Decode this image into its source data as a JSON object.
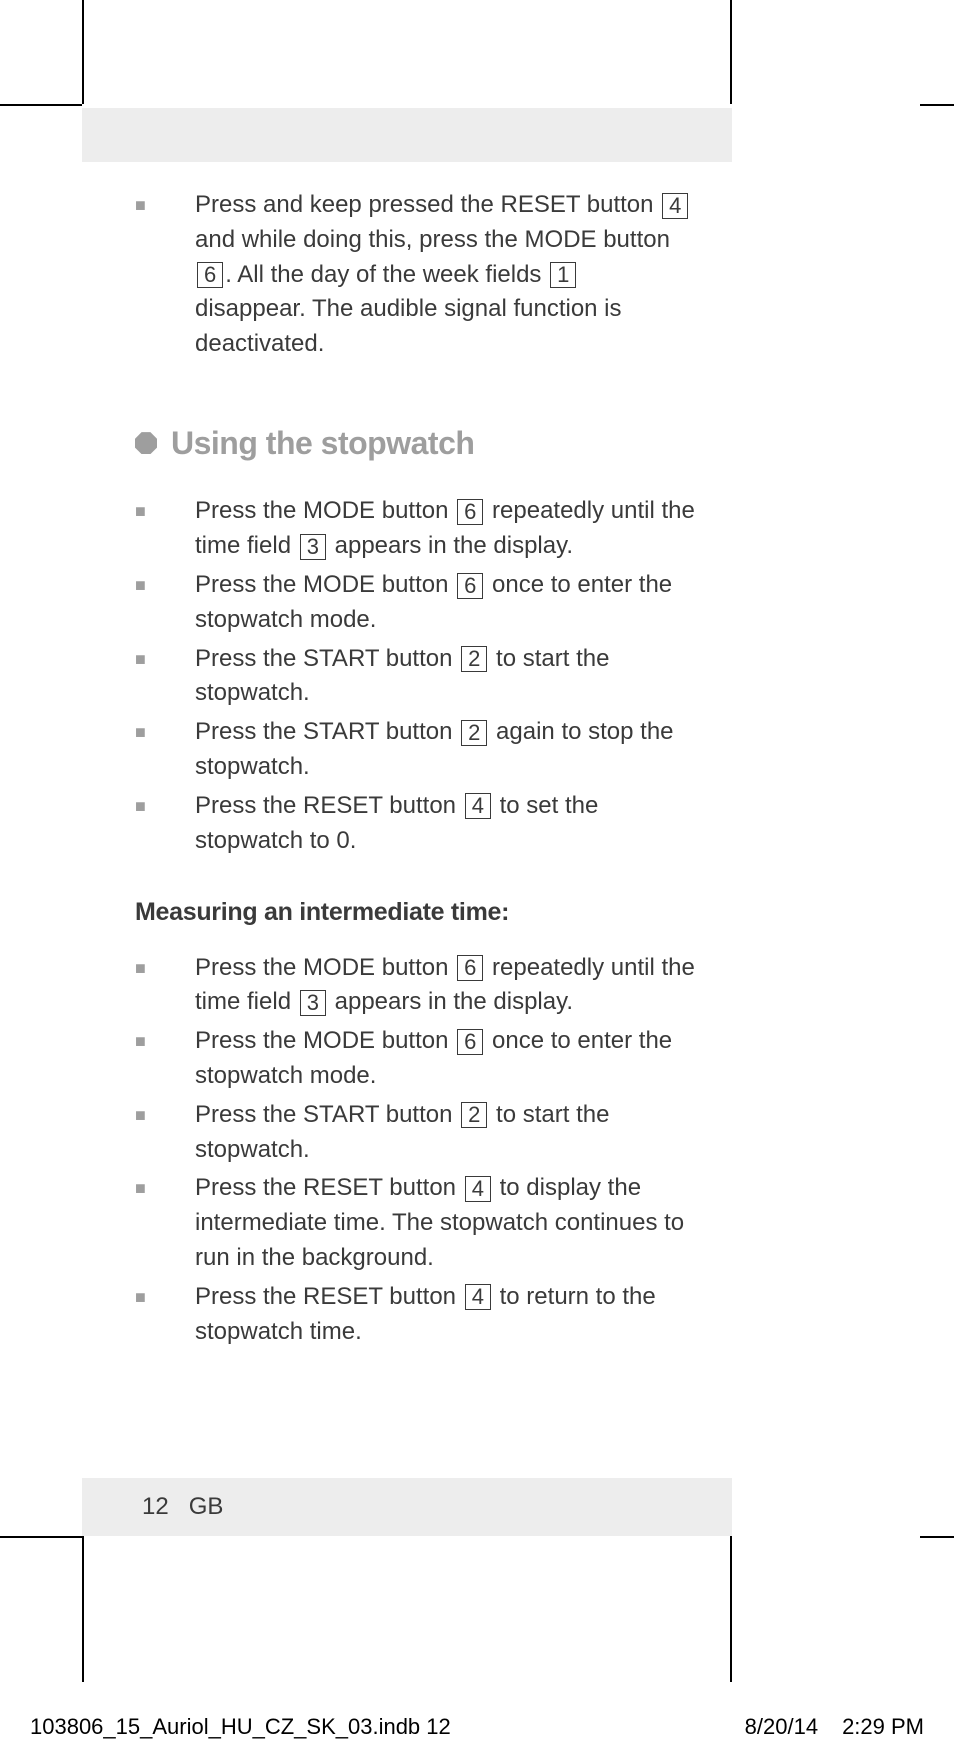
{
  "intro": {
    "pre": "Press and keep pressed the RESET button ",
    "n1": "4",
    "mid1": " and while doing this, press the MODE button ",
    "n2": "6",
    "mid2": ". All the day of the week fields ",
    "n3": "1",
    "tail": " disappear. The audible signal function is deactivated."
  },
  "heading": "Using the stopwatch",
  "s1": {
    "a": "Press the MODE button ",
    "n1": "6",
    "b": " repeatedly until the time field ",
    "n2": "3",
    "c": " appears in the display."
  },
  "s2": {
    "a": "Press the MODE button ",
    "n1": "6",
    "b": " once to enter the stopwatch mode."
  },
  "s3": {
    "a": "Press the START button ",
    "n1": "2",
    "b": " to start the stopwatch."
  },
  "s4": {
    "a": "Press the START button ",
    "n1": "2",
    "b": " again to stop the stopwatch."
  },
  "s5": {
    "a": "Press the RESET button ",
    "n1": "4",
    "b": " to set the stopwatch to 0."
  },
  "subhead": "Measuring an intermediate time:",
  "m1": {
    "a": "Press the MODE button ",
    "n1": "6",
    "b": " repeatedly until the time field ",
    "n2": "3",
    "c": " appears in the display."
  },
  "m2": {
    "a": "Press the MODE button ",
    "n1": "6",
    "b": " once to enter the stopwatch mode."
  },
  "m3": {
    "a": "Press the START button ",
    "n1": "2",
    "b": " to start the stopwatch."
  },
  "m4": {
    "a": "Press the RESET button ",
    "n1": "4",
    "b": " to display the intermediate time. The stopwatch continues to run in the background."
  },
  "m5": {
    "a": "Press the RESET button ",
    "n1": "4",
    "b": " to return to the stopwatch time."
  },
  "footer": {
    "page": "12",
    "lang": "GB",
    "file": "103806_15_Auriol_HU_CZ_SK_03.indb   12",
    "date": "8/20/14",
    "time": "2:29 PM"
  }
}
